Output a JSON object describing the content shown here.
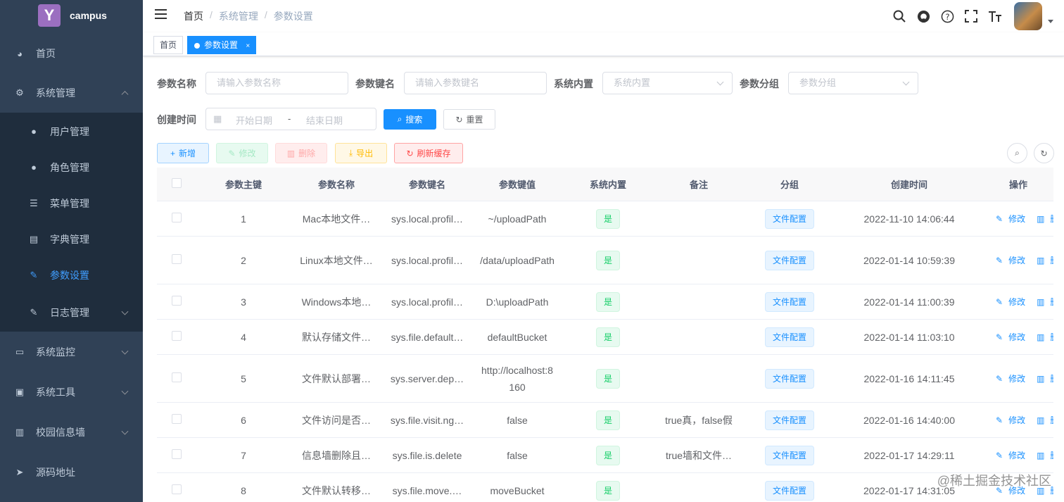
{
  "app": {
    "logo_letter": "Y",
    "name": "campus"
  },
  "sidebar": {
    "items": [
      {
        "label": "首页",
        "icon": "dashboard-icon"
      },
      {
        "label": "系统管理",
        "icon": "gear-icon"
      },
      {
        "label": "系统监控",
        "icon": "monitor-icon"
      },
      {
        "label": "系统工具",
        "icon": "toolbox-icon"
      },
      {
        "label": "校园信息墙",
        "icon": "book-icon"
      },
      {
        "label": "源码地址",
        "icon": "send-icon"
      }
    ],
    "submenu": [
      {
        "label": "用户管理",
        "icon": "user-icon"
      },
      {
        "label": "角色管理",
        "icon": "users-icon"
      },
      {
        "label": "菜单管理",
        "icon": "tree-icon"
      },
      {
        "label": "字典管理",
        "icon": "dict-icon"
      },
      {
        "label": "参数设置",
        "icon": "edit-icon"
      },
      {
        "label": "日志管理",
        "icon": "log-icon"
      }
    ]
  },
  "header": {
    "breadcrumb": [
      "首页",
      "系统管理",
      "参数设置"
    ],
    "separator": "/"
  },
  "tags": [
    {
      "label": "首页"
    },
    {
      "label": "参数设置",
      "close": "×"
    }
  ],
  "search": {
    "param_name_label": "参数名称",
    "param_name_placeholder": "请输入参数名称",
    "param_key_label": "参数键名",
    "param_key_placeholder": "请输入参数键名",
    "builtin_label": "系统内置",
    "builtin_placeholder": "系统内置",
    "group_label": "参数分组",
    "group_placeholder": "参数分组",
    "created_label": "创建时间",
    "start_placeholder": "开始日期",
    "range_sep": "-",
    "end_placeholder": "结束日期",
    "search_btn": "搜索",
    "reset_btn": "重置"
  },
  "toolbar": {
    "add": "新增",
    "edit": "修改",
    "delete": "删除",
    "export": "导出",
    "refresh_cache": "刷新缓存"
  },
  "table": {
    "columns": [
      "参数主键",
      "参数名称",
      "参数键名",
      "参数键值",
      "系统内置",
      "备注",
      "分组",
      "创建时间",
      "操作"
    ],
    "edit_label": "修改",
    "delete_label": "删除",
    "rows": [
      {
        "id": "1",
        "name": "Mac本地文件…",
        "key": "sys.local.profil…",
        "value": "~/uploadPath",
        "builtin": "是",
        "remark": "",
        "group": "文件配置",
        "created": "2022-11-10 14:06:44"
      },
      {
        "id": "2",
        "name": "Linux本地文件…",
        "key": "sys.local.profil…",
        "value": "/data/uploadPath",
        "builtin": "是",
        "remark": "",
        "group": "文件配置",
        "created": "2022-01-14 10:59:39"
      },
      {
        "id": "3",
        "name": "Windows本地…",
        "key": "sys.local.profil…",
        "value": "D:\\uploadPath",
        "builtin": "是",
        "remark": "",
        "group": "文件配置",
        "created": "2022-01-14 11:00:39"
      },
      {
        "id": "4",
        "name": "默认存储文件…",
        "key": "sys.file.default…",
        "value": "defaultBucket",
        "builtin": "是",
        "remark": "",
        "group": "文件配置",
        "created": "2022-01-14 11:03:10"
      },
      {
        "id": "5",
        "name": "文件默认部署…",
        "key": "sys.server.dep…",
        "value": "http://localhost:8160",
        "builtin": "是",
        "remark": "",
        "group": "文件配置",
        "created": "2022-01-16 14:11:45"
      },
      {
        "id": "6",
        "name": "文件访问是否…",
        "key": "sys.file.visit.ng…",
        "value": "false",
        "builtin": "是",
        "remark": "true真，false假",
        "group": "文件配置",
        "created": "2022-01-16 14:40:00"
      },
      {
        "id": "7",
        "name": "信息墙删除且…",
        "key": "sys.file.is.delete",
        "value": "false",
        "builtin": "是",
        "remark": "true墙和文件…",
        "group": "文件配置",
        "created": "2022-01-17 14:29:11"
      },
      {
        "id": "8",
        "name": "文件默认转移…",
        "key": "sys.file.move.…",
        "value": "moveBucket",
        "builtin": "是",
        "remark": "",
        "group": "文件配置",
        "created": "2022-01-17 14:31:05"
      }
    ]
  },
  "watermark": "@稀土掘金技术社区",
  "colors": {
    "sidebar": "#304156",
    "submenu": "#1f2d3d",
    "primary": "#1890ff",
    "success": "#13ce66"
  }
}
